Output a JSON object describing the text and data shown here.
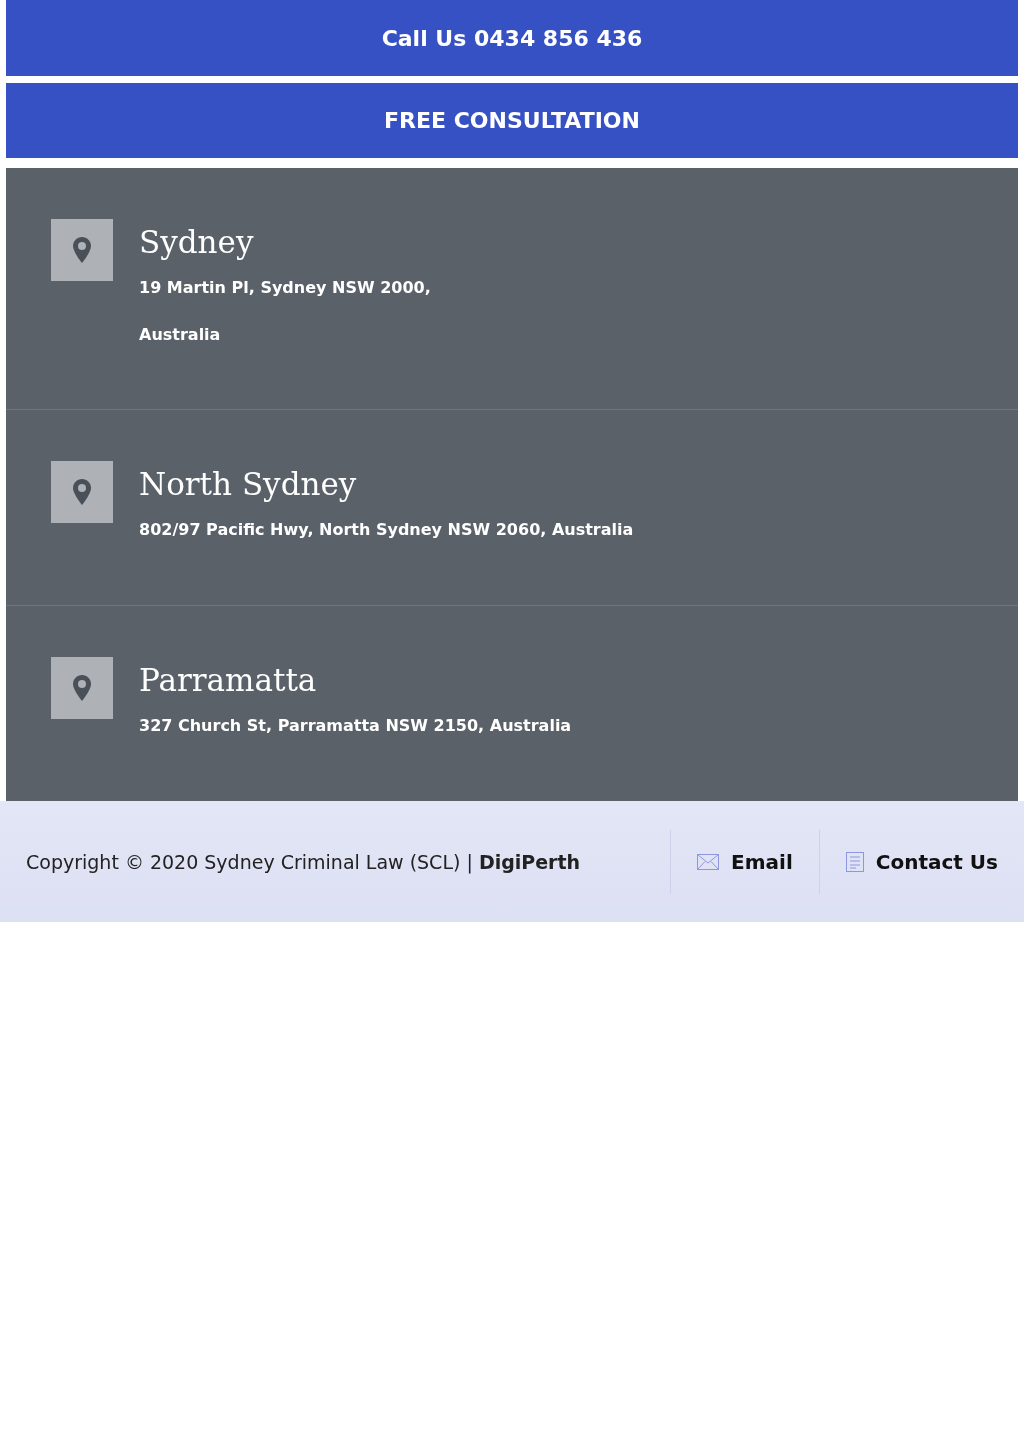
{
  "buttons": [
    {
      "label": "Call Us 0434 856 436"
    },
    {
      "label": "FREE CONSULTATION"
    }
  ],
  "locations": [
    {
      "name": "Sydney",
      "address_lines": [
        "19 Martin Pl, Sydney NSW 2000,",
        "Australia"
      ]
    },
    {
      "name": "North Sydney",
      "address_lines": [
        "802/97 Pacific Hwy, North Sydney NSW 2060, Australia"
      ]
    },
    {
      "name": "Parramatta",
      "address_lines": [
        "327 Church St, Parramatta NSW 2150, Australia"
      ]
    }
  ],
  "footer": {
    "copyright": "Copyright © 2020 Sydney Criminal Law (SCL) | **DigiPerth**",
    "links": [
      {
        "kind": "email",
        "label": "Email"
      },
      {
        "kind": "contact",
        "label": "Contact Us"
      }
    ]
  }
}
